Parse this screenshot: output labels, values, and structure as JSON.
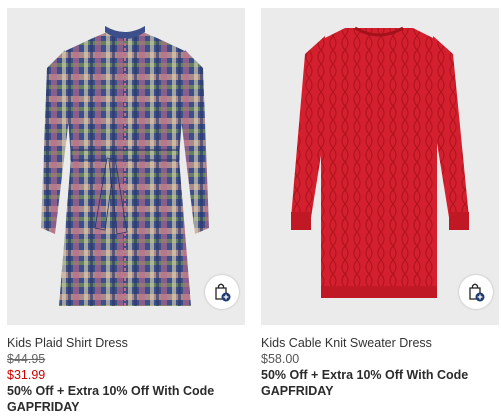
{
  "products": [
    {
      "name": "Kids Plaid Shirt Dress",
      "original_price": "$44.95",
      "sale_price": "$31.99",
      "promo": "50% Off + Extra 10% Off With Code GAPFRIDAY"
    },
    {
      "name": "Kids Cable Knit Sweater Dress",
      "price": "$58.00",
      "promo": "50% Off + Extra 10% Off With Code GAPFRIDAY"
    }
  ],
  "colors": {
    "sale_price": "#d00000",
    "image_bg": "#ebebeb",
    "sweater_red": "#d4202e"
  },
  "icons": [
    "shopping-bag-add-icon"
  ]
}
